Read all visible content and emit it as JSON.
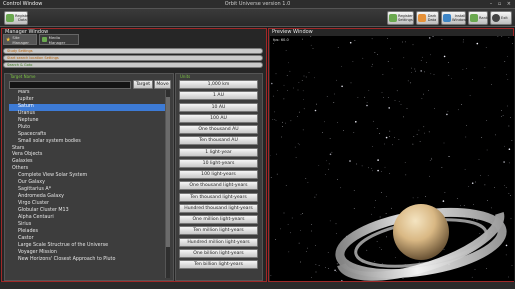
{
  "window": {
    "title": "Control Window",
    "center_title": "Orbit Universe version 1.0",
    "controls": "– ▫ ×"
  },
  "toolbar": {
    "left": [
      {
        "label": "Register Data",
        "icon": "register-icon",
        "color": "#6aa84f"
      }
    ],
    "right": [
      {
        "label": "Register Settings",
        "icon": "settings-icon",
        "color": "#6aa84f"
      },
      {
        "label": "Dark Data",
        "icon": "dark-data-icon",
        "color": "#e69138"
      },
      {
        "label": "Install Windows",
        "icon": "windows-icon",
        "color": "#3d85c6"
      },
      {
        "label": "Rank",
        "icon": "rank-icon",
        "color": "#6aa84f"
      },
      {
        "label": "Exit",
        "icon": "exit-icon",
        "color": "#444444"
      }
    ]
  },
  "manager": {
    "title": "Manager Window",
    "tabs": [
      {
        "label": "Site Manager",
        "icon": "star-icon",
        "color": "#f1c232"
      },
      {
        "label": "Media Manager",
        "icon": "media-icon",
        "color": "#6aa84f"
      }
    ],
    "sections": [
      "Study Settings",
      "Start search location Settings",
      "Search & Goto"
    ],
    "target_label": "Target Name",
    "target_value": "",
    "target_button": "Target",
    "move_button": "Move",
    "units_label": "Units",
    "tree": [
      {
        "label": "Mars",
        "level": 2
      },
      {
        "label": "Jupiter",
        "level": 2
      },
      {
        "label": "Saturn",
        "level": 2,
        "selected": true
      },
      {
        "label": "Uranus",
        "level": 2
      },
      {
        "label": "Neptune",
        "level": 2
      },
      {
        "label": "Pluto",
        "level": 2
      },
      {
        "label": "Spacecrafts",
        "level": 2
      },
      {
        "label": "Small solar system bodies",
        "level": 2
      },
      {
        "label": "Stars",
        "level": 1
      },
      {
        "label": "Vera Objects",
        "level": 1
      },
      {
        "label": "Galaxies",
        "level": 1
      },
      {
        "label": "Others",
        "level": 1
      },
      {
        "label": "Complete View Solar System",
        "level": 2
      },
      {
        "label": "Our Galaxy",
        "level": 2
      },
      {
        "label": "Sagittarius A*",
        "level": 2
      },
      {
        "label": "Andromeda Galaxy",
        "level": 2
      },
      {
        "label": "Virgo Cluster",
        "level": 2
      },
      {
        "label": "Globular Cluster M13",
        "level": 2
      },
      {
        "label": "Alpha Centauri",
        "level": 2
      },
      {
        "label": "Sirius",
        "level": 2
      },
      {
        "label": "Pleiades",
        "level": 2
      },
      {
        "label": "Castor",
        "level": 2
      },
      {
        "label": "Large Scale Structrue of the Universe",
        "level": 2
      },
      {
        "label": "Voyager Mission",
        "level": 2
      },
      {
        "label": "New Horizons' Closest Approach to Pluto",
        "level": 2
      }
    ],
    "units": [
      "1,000 km",
      "1 AU",
      "10 AU",
      "100 AU",
      "One thousand AU",
      "Ten thousand AU",
      "1 light-year",
      "10 light-years",
      "100 light-years",
      "One thousand light-years",
      "Ten thousand light-years",
      "Hundred thousand light-years",
      "One million light-years",
      "Ten million light-years",
      "Hundred million light-years",
      "One billion light-years",
      "Ten billion light-years"
    ]
  },
  "preview": {
    "title": "Preview Window",
    "info": "fps: 60.0"
  }
}
